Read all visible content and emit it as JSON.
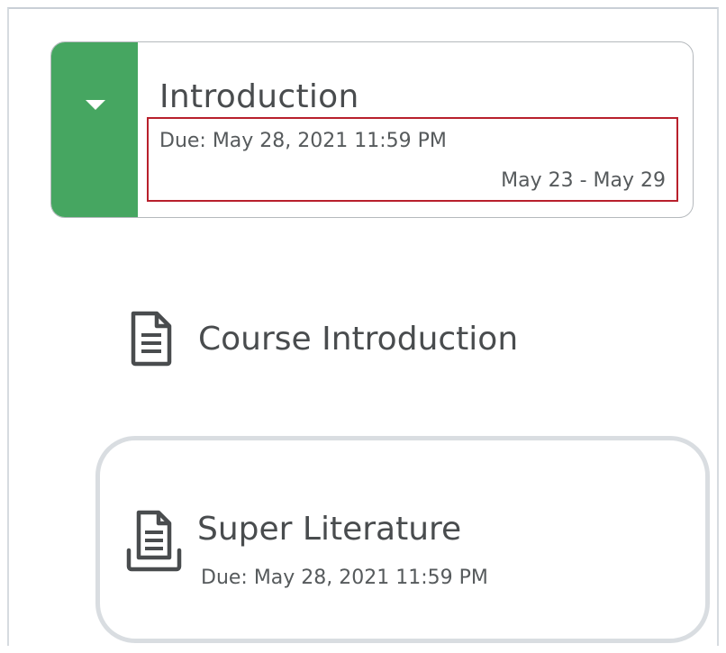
{
  "module": {
    "title": "Introduction",
    "due": "Due: May 28, 2021 11:59 PM",
    "date_range": "May 23 - May 29",
    "toggle_color": "#46a661",
    "highlight_color": "#b8202c"
  },
  "topics": [
    {
      "title": "Course Introduction",
      "icon": "document-icon"
    },
    {
      "title": "Super Literature",
      "due": "Due: May 28, 2021 11:59 PM",
      "icon": "assignment-submit-icon",
      "selected": true
    }
  ]
}
